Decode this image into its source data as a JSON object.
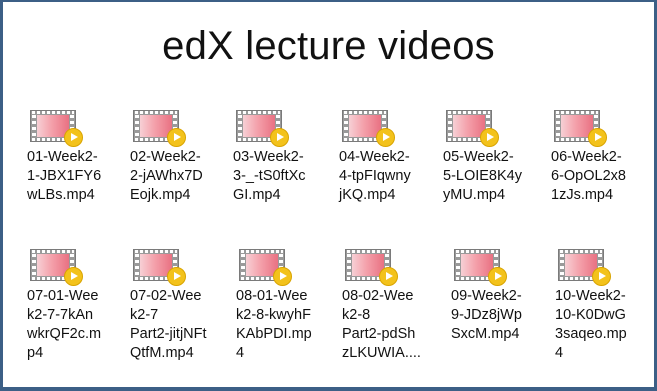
{
  "window": {
    "title": "edX lecture videos"
  },
  "files": [
    {
      "name": "01-Week2-\n1-JBX1FY6\nwLBs.mp4",
      "icon": "video-file-icon"
    },
    {
      "name": "02-Week2-\n2-jAWhx7D\nEojk.mp4",
      "icon": "video-file-icon"
    },
    {
      "name": "03-Week2-\n3-_-tS0ftXc\nGI.mp4",
      "icon": "video-file-icon"
    },
    {
      "name": "04-Week2-\n4-tpFIqwny\njKQ.mp4",
      "icon": "video-file-icon"
    },
    {
      "name": "05-Week2-\n5-LOIE8K4y\nyMU.mp4",
      "icon": "video-file-icon"
    },
    {
      "name": "06-Week2-\n6-OpOL2x8\n1zJs.mp4",
      "icon": "video-file-icon"
    },
    {
      "name": "07-01-Wee\nk2-7-7kAn\nwkrQF2c.m\np4",
      "icon": "video-file-icon"
    },
    {
      "name": "07-02-Wee\nk2-7\nPart2-jitjNFt\nQtfM.mp4",
      "icon": "video-file-icon"
    },
    {
      "name": "08-01-Wee\nk2-8-kwyhF\nKAbPDI.mp\n4",
      "icon": "video-file-icon"
    },
    {
      "name": "08-02-Wee\nk2-8\nPart2-pdSh\nzLKUWIA....",
      "icon": "video-file-icon"
    },
    {
      "name": "09-Week2-\n9-JDz8jWp\nSxcM.mp4",
      "icon": "video-file-icon"
    },
    {
      "name": "10-Week2-\n10-K0DwG\n3saqeo.mp\n4",
      "icon": "video-file-icon"
    }
  ],
  "colors": {
    "border": "#3c5f86",
    "play_badge": "#f3c21b",
    "film_frame": "#f4a1ab"
  }
}
